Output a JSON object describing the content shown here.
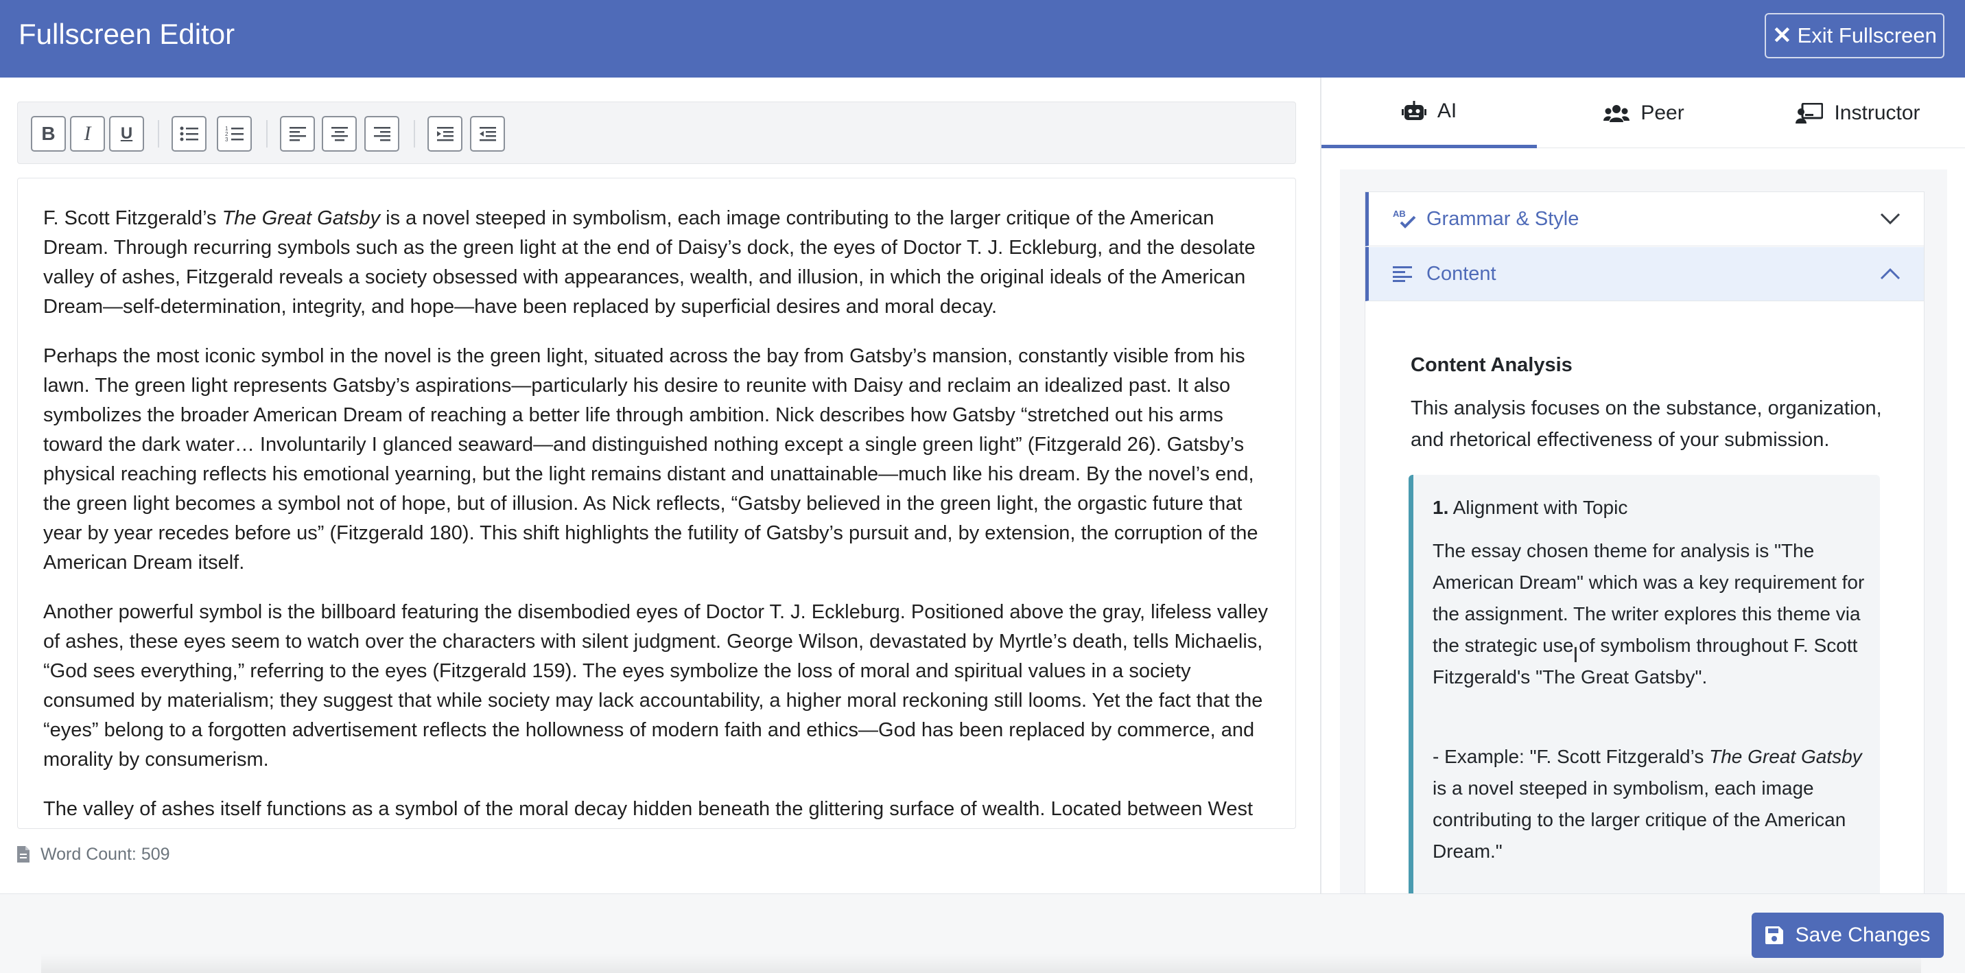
{
  "header": {
    "title": "Fullscreen Editor",
    "exit_label": "Exit Fullscreen"
  },
  "toolbar": {
    "buttons": [
      "bold-icon",
      "italic-icon",
      "underline-icon",
      "bulleted-list-icon",
      "numbered-list-icon",
      "align-left-icon",
      "align-center-icon",
      "align-right-icon",
      "indent-icon",
      "outdent-icon"
    ]
  },
  "document": {
    "p1_pre": "F. Scott Fitzgerald’s ",
    "p1_title": "The Great Gatsby",
    "p1_post": " is a novel steeped in symbolism, each image contributing to the larger critique of the American Dream. Through recurring symbols such as the green light at the end of Daisy’s dock, the eyes of Doctor T. J. Eckleburg, and the desolate valley of ashes, Fitzgerald reveals a society obsessed with appearances, wealth, and illusion, in which the original ideals of the American Dream—self-determination, integrity, and hope—have been replaced by superficial desires and moral decay.",
    "p2": "Perhaps the most iconic symbol in the novel is the green light, situated across the bay from Gatsby’s mansion, constantly visible from his lawn. The green light represents Gatsby’s aspirations—particularly his desire to reunite with Daisy and reclaim an idealized past. It also symbolizes the broader American Dream of reaching a better life through ambition. Nick describes how Gatsby “stretched out his arms toward the dark water… Involuntarily I glanced seaward—and distinguished nothing except a single green light” (Fitzgerald 26). Gatsby’s physical reaching reflects his emotional yearning, but the light remains distant and unattainable—much like his dream. By the novel’s end, the green light becomes a symbol not of hope, but of illusion. As Nick reflects, “Gatsby believed in the green light, the orgastic future that year by year recedes before us” (Fitzgerald 180). This shift highlights the futility of Gatsby’s pursuit and, by extension, the corruption of the American Dream itself.",
    "p3": "Another powerful symbol is the billboard featuring the disembodied eyes of Doctor T. J. Eckleburg. Positioned above the gray, lifeless valley of ashes, these eyes seem to watch over the characters with silent judgment. George Wilson, devastated by Myrtle’s death, tells Michaelis, “God sees everything,” referring to the eyes (Fitzgerald 159). The eyes symbolize the loss of moral and spiritual values in a society consumed by materialism; they suggest that while society may lack accountability, a higher moral reckoning still looms. Yet the fact that the “eyes” belong to a forgotten advertisement reflects the hollowness of modern faith and ethics—God has been replaced by commerce, and morality by consumerism.",
    "p4": "The valley of ashes itself functions as a symbol of the moral decay hidden beneath the glittering surface of wealth. Located between West"
  },
  "status": {
    "word_count": "Word Count: 509"
  },
  "tabs": [
    {
      "label": "AI",
      "icon": "robot-icon"
    },
    {
      "label": "Peer",
      "icon": "users-icon"
    },
    {
      "label": "Instructor",
      "icon": "chalkboard-teacher-icon"
    }
  ],
  "accordion": {
    "grammar_label": "Grammar & Style",
    "content_label": "Content"
  },
  "analysis": {
    "title": "Content Analysis",
    "intro": "This analysis focuses on the substance, organization, and rhetorical effectiveness of your submission.",
    "item_number": "1.",
    "item_title": " Alignment with Topic",
    "item_text": "The essay chosen theme for analysis is \"The American Dream\" which was a key requirement for the assignment. The writer explores this theme via the strategic use of symbolism throughout F. Scott Fitzgerald's \"The Great Gatsby\".",
    "example_pre": "- Example: \"F. Scott Fitzgerald’s ",
    "example_title": "The Great Gatsby",
    "example_post": " is a novel steeped in symbolism, each image contributing to the larger critique of the American Dream.\""
  },
  "footer": {
    "save_label": "Save Changes"
  },
  "colors": {
    "primary": "#4f6bb8",
    "accent_teal": "#4a9bb0",
    "panel_bg": "#f5f6f8"
  }
}
